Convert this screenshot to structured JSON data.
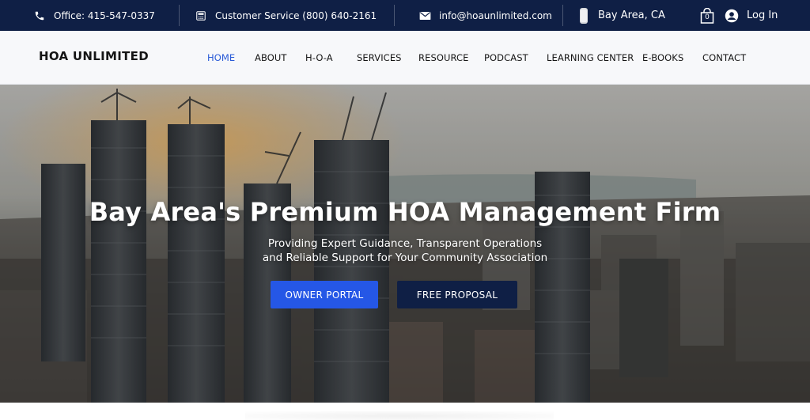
{
  "topbar": {
    "office": "Office: 415-547-0337",
    "customer_service": "Customer Service (800) 640-2161",
    "email": "info@hoaunlimited.com",
    "location": "Bay Area, CA",
    "cart_count": "0",
    "login": "Log In",
    "background_color": "#0f1f45"
  },
  "navbar": {
    "logo_text": "HOA UNLIMITED",
    "items": [
      {
        "label": "HOME"
      },
      {
        "label": "ABOUT"
      },
      {
        "label": "H-O-A"
      },
      {
        "label": "SERVICES"
      },
      {
        "label": "RESOURCE"
      },
      {
        "label": "PODCAST"
      },
      {
        "label": "LEARNING CENTER"
      },
      {
        "label": "E-BOOKS"
      },
      {
        "label": "CONTACT"
      }
    ],
    "active_color": "#2a5bd7"
  },
  "hero": {
    "title": "Bay Area's Premium HOA Management Firm",
    "subtitle_line1": "Providing Expert Guidance, Transparent Operations",
    "subtitle_line2": "and Reliable Support for Your Community Association",
    "primary_button": "OWNER PORTAL",
    "secondary_button": "FREE PROPOSAL",
    "primary_color": "#2557e6",
    "secondary_color": "#0f1f45"
  },
  "icons": {
    "phone": "phone-icon",
    "service": "calculator-icon",
    "email": "envelope-icon",
    "location": "building-icon",
    "cart": "cart-icon",
    "user": "user-icon"
  }
}
